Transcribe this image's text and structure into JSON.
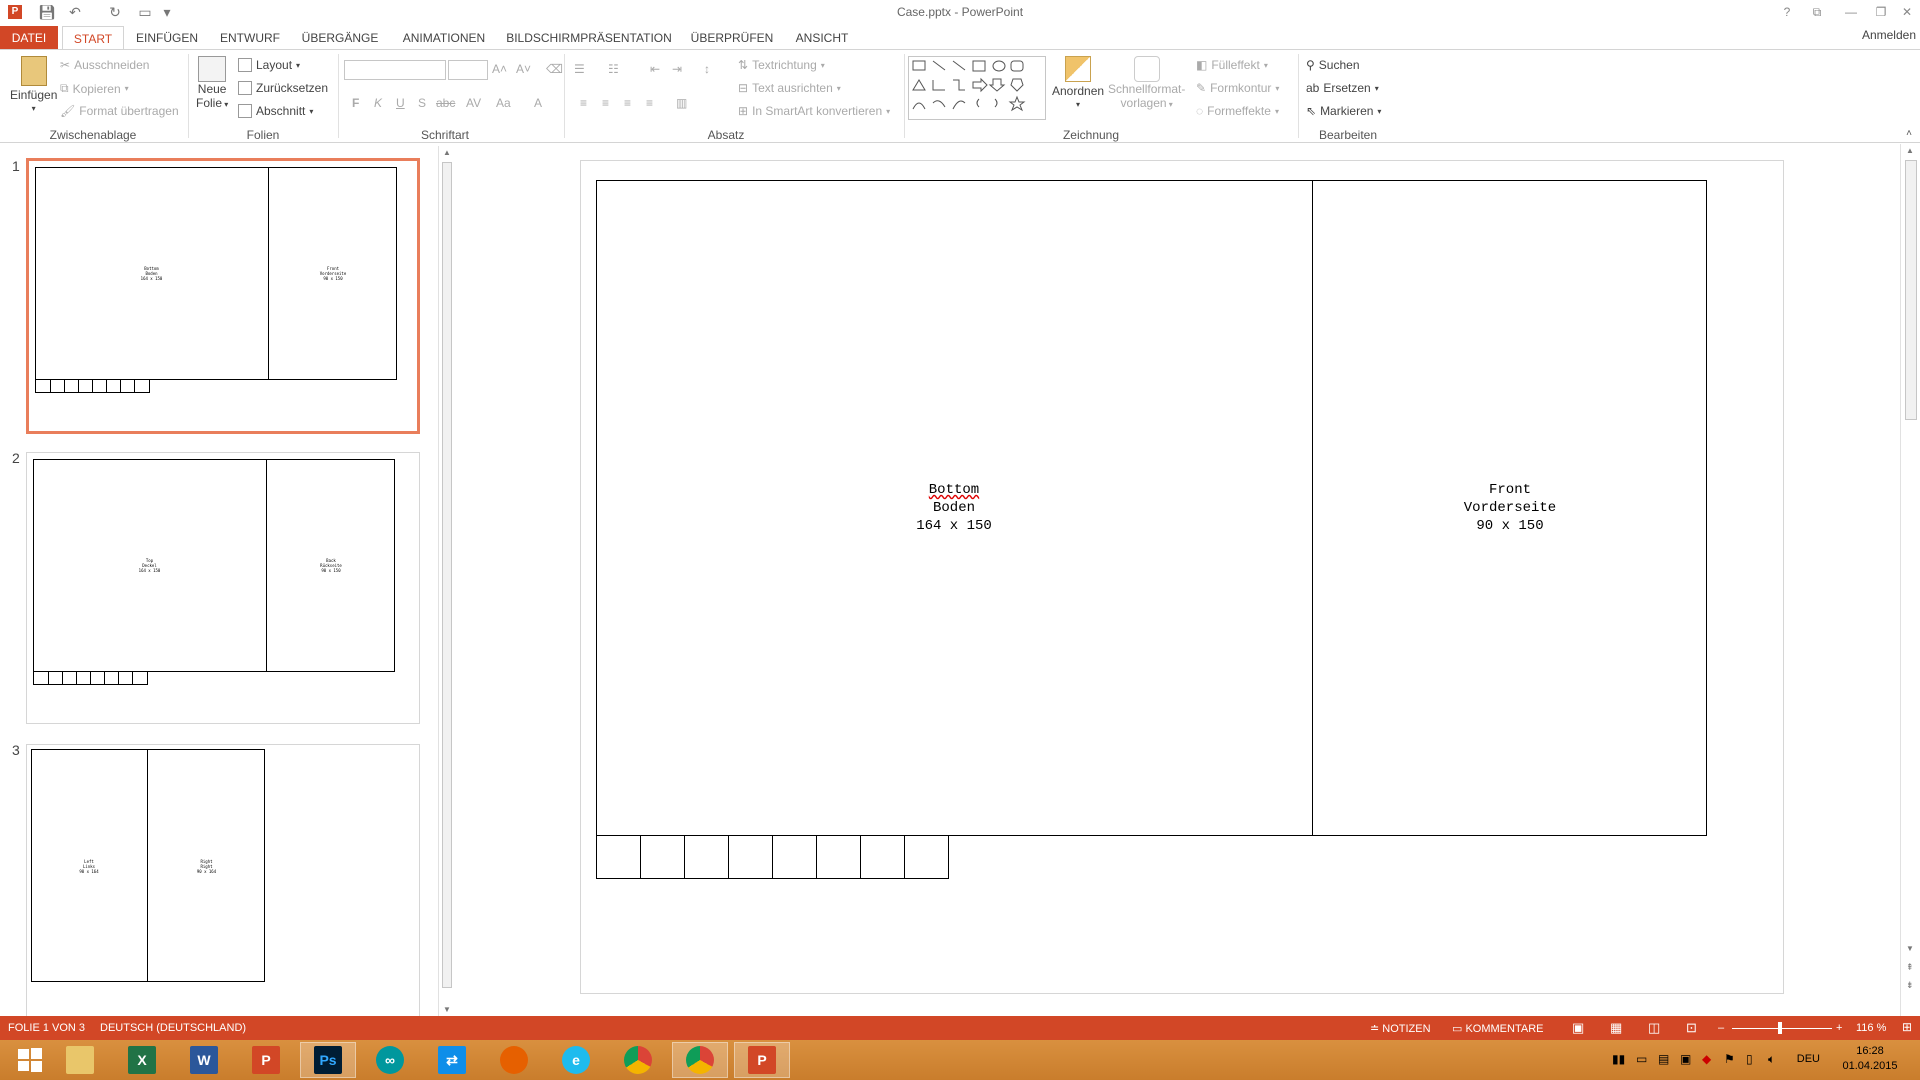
{
  "window": {
    "title": "Case.pptx - PowerPoint",
    "sign_in": "Anmelden"
  },
  "tabs": [
    "DATEI",
    "START",
    "EINFÜGEN",
    "ENTWURF",
    "ÜBERGÄNGE",
    "ANIMATIONEN",
    "BILDSCHIRMPRÄSENTATION",
    "ÜBERPRÜFEN",
    "ANSICHT"
  ],
  "ribbon": {
    "clipboard": {
      "paste": "Einfügen",
      "cut": "Ausschneiden",
      "copy": "Kopieren",
      "format_painter": "Format übertragen",
      "label": "Zwischenablage"
    },
    "slides": {
      "new_slide_1": "Neue",
      "new_slide_2": "Folie",
      "layout": "Layout",
      "reset": "Zurücksetzen",
      "section": "Abschnitt",
      "label": "Folien"
    },
    "font": {
      "bold": "F",
      "italic": "K",
      "underline": "U",
      "strike": "S",
      "label": "Schriftart"
    },
    "paragraph": {
      "text_direction": "Textrichtung",
      "align_text": "Text ausrichten",
      "smartart": "In SmartArt konvertieren",
      "label": "Absatz"
    },
    "drawing": {
      "arrange": "Anordnen",
      "quick_styles_1": "Schnellformat-",
      "quick_styles_2": "vorlagen",
      "fill": "Fülleffekt",
      "outline": "Formkontur",
      "effects": "Formeffekte",
      "label": "Zeichnung"
    },
    "editing": {
      "find": "Suchen",
      "replace": "Ersetzen",
      "select": "Markieren",
      "label": "Bearbeiten"
    }
  },
  "thumbnails": [
    {
      "num": "1",
      "left_label": "Bottom\nBoden\n164 x 150",
      "right_label": "Front\nVorderseite\n90 x 150"
    },
    {
      "num": "2",
      "left_label": "Top\nDeckel\n164 x 150",
      "right_label": "Back\nRückseite\n90 x 150"
    },
    {
      "num": "3",
      "left_label": "Left\nLinks\n90 x 164",
      "right_label": "Right\nRight\n90 x 164"
    }
  ],
  "slide": {
    "left_line1": "Bottom",
    "left_line2": "Boden",
    "left_line3": "164 x 150",
    "right_line1": "Front",
    "right_line2": "Vorderseite",
    "right_line3": "90 x 150"
  },
  "status": {
    "slide_info": "FOLIE 1 VON 3",
    "language": "DEUTSCH (DEUTSCHLAND)",
    "notes": "NOTIZEN",
    "comments": "KOMMENTARE",
    "zoom": "116 %"
  },
  "taskbar": {
    "lang": "DEU",
    "time": "16:28",
    "date": "01.04.2015"
  },
  "colors": {
    "accent": "#d24726",
    "thumb_selected": "#e97e5b",
    "taskbar": "#d9903f"
  }
}
